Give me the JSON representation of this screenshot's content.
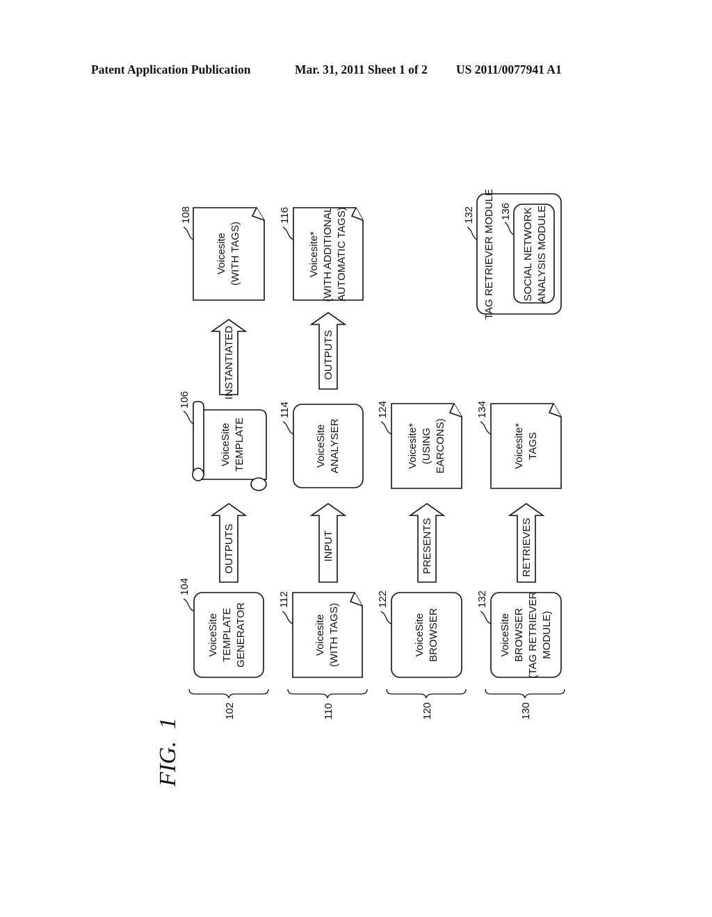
{
  "header": {
    "publication": "Patent Application Publication",
    "date_sheet": "Mar. 31, 2011  Sheet 1 of 2",
    "number": "US 2011/0077941 A1"
  },
  "figure": {
    "label": "FIG.  1",
    "groups": [
      {
        "ref": "102"
      },
      {
        "ref": "110"
      },
      {
        "ref": "120"
      },
      {
        "ref": "130"
      }
    ],
    "rows": [
      {
        "source": {
          "ref": "104",
          "shape": "rounded",
          "lines": [
            "VoiceSite",
            "TEMPLATE",
            "GENERATOR"
          ]
        },
        "arrow1": "OUTPUTS",
        "middle": {
          "ref": "106",
          "shape": "scroll",
          "lines": [
            "VoiceSite",
            "TEMPLATE"
          ]
        },
        "arrow2": "INSTANTIATED",
        "target": {
          "ref": "108",
          "shape": "document",
          "lines": [
            "Voicesite",
            "(WITH TAGS)"
          ]
        }
      },
      {
        "source": {
          "ref": "112",
          "shape": "document",
          "lines": [
            "Voicesite",
            "(WITH TAGS)"
          ]
        },
        "arrow1": "INPUT",
        "middle": {
          "ref": "114",
          "shape": "rounded",
          "lines": [
            "VoiceSite",
            "ANALYSER"
          ]
        },
        "arrow2": "OUTPUTS",
        "target": {
          "ref": "116",
          "shape": "document",
          "lines": [
            "Voicesite*",
            "(WITH ADDITIONAL",
            "AUTOMATIC TAGS)"
          ]
        }
      },
      {
        "source": {
          "ref": "122",
          "shape": "rounded",
          "lines": [
            "VoiceSite",
            "BROWSER"
          ]
        },
        "arrow1": "PRESENTS",
        "middle": {
          "ref": "124",
          "shape": "document",
          "lines": [
            "Voicesite*",
            "(USING",
            "EARCONS)"
          ]
        }
      },
      {
        "source": {
          "ref": "132",
          "shape": "rounded",
          "lines": [
            "VoiceSite",
            "BROWSER",
            "(TAG RETRIEVER",
            "MODULE)"
          ]
        },
        "arrow1": "RETRIEVES",
        "middle": {
          "ref": "134",
          "shape": "document",
          "lines": [
            "Voicesite*",
            "TAGS"
          ]
        }
      }
    ],
    "module": {
      "ref": "132",
      "title": "TAG RETRIEVER MODULE",
      "inner": {
        "ref": "136",
        "lines": [
          "SOCIAL NETWORK",
          "ANALYSIS MODULE"
        ]
      }
    }
  }
}
